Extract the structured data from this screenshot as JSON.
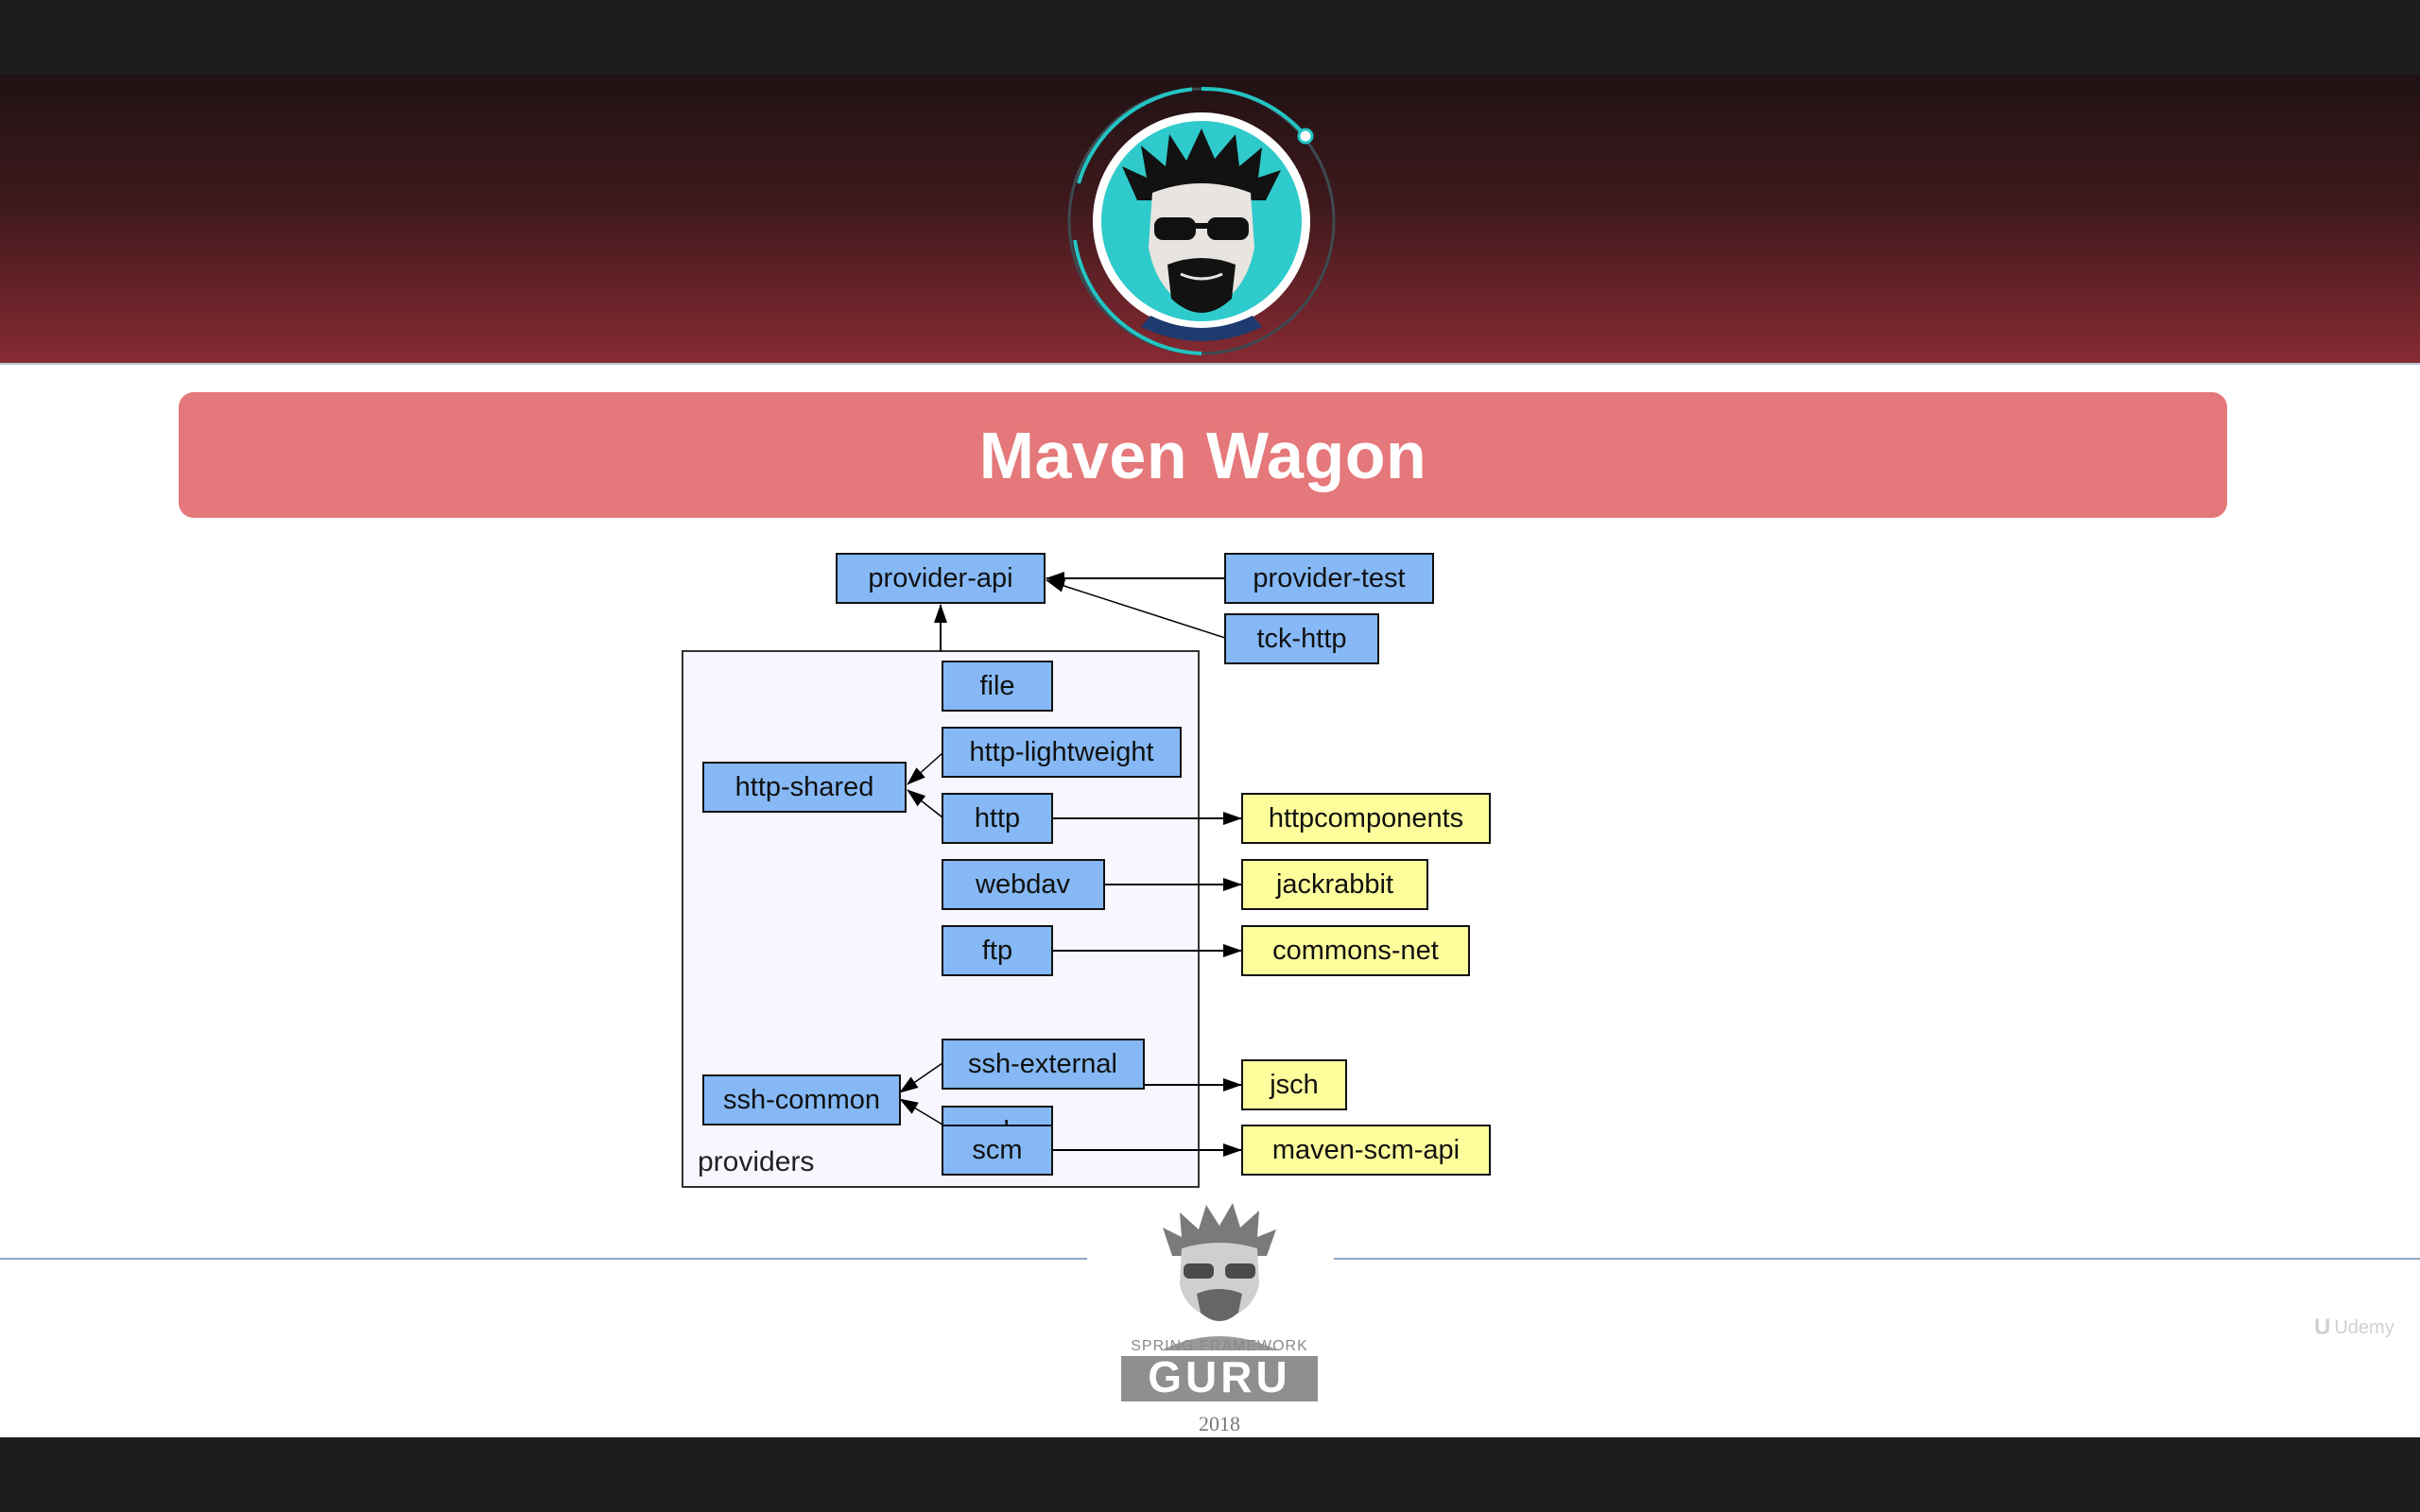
{
  "slide": {
    "title": "Maven Wagon",
    "year": "2018",
    "logo_text": [
      "SPRING FRAMEWORK",
      "GURU"
    ],
    "watermark": "Udemy"
  },
  "colors": {
    "banner_top": "#201214",
    "banner_bottom": "#872a32",
    "title_bar": "#e5787a",
    "module_box": "#85b8f5",
    "external_box": "#fdfd9c",
    "group_fill": "#f8f6fe",
    "avatar_teal": "#22c5c4"
  },
  "icons": [
    "avatar-icon",
    "guru-logo-icon",
    "udemy-logo-icon"
  ],
  "diagram": {
    "group": {
      "label": "providers"
    },
    "nodes": [
      {
        "id": "provider-api",
        "label": "provider-api",
        "kind": "module"
      },
      {
        "id": "provider-test",
        "label": "provider-test",
        "kind": "module"
      },
      {
        "id": "tck-http",
        "label": "tck-http",
        "kind": "module"
      },
      {
        "id": "file",
        "label": "file",
        "kind": "module"
      },
      {
        "id": "http-lightweight",
        "label": "http-lightweight",
        "kind": "module"
      },
      {
        "id": "http-shared",
        "label": "http-shared",
        "kind": "module"
      },
      {
        "id": "http",
        "label": "http",
        "kind": "module"
      },
      {
        "id": "webdav",
        "label": "webdav",
        "kind": "module"
      },
      {
        "id": "ftp",
        "label": "ftp",
        "kind": "module"
      },
      {
        "id": "ssh-external",
        "label": "ssh-external",
        "kind": "module"
      },
      {
        "id": "ssh-common",
        "label": "ssh-common",
        "kind": "module"
      },
      {
        "id": "ssh",
        "label": "ssh",
        "kind": "module"
      },
      {
        "id": "scm",
        "label": "scm",
        "kind": "module"
      },
      {
        "id": "httpcomponents",
        "label": "httpcomponents",
        "kind": "external"
      },
      {
        "id": "jackrabbit",
        "label": "jackrabbit",
        "kind": "external"
      },
      {
        "id": "commons-net",
        "label": "commons-net",
        "kind": "external"
      },
      {
        "id": "jsch",
        "label": "jsch",
        "kind": "external"
      },
      {
        "id": "maven-scm-api",
        "label": "maven-scm-api",
        "kind": "external"
      }
    ],
    "edges": [
      {
        "from": "providers",
        "to": "provider-api"
      },
      {
        "from": "provider-test",
        "to": "provider-api"
      },
      {
        "from": "tck-http",
        "to": "provider-api"
      },
      {
        "from": "http-lightweight",
        "to": "http-shared"
      },
      {
        "from": "http",
        "to": "http-shared"
      },
      {
        "from": "http",
        "to": "httpcomponents"
      },
      {
        "from": "webdav",
        "to": "jackrabbit"
      },
      {
        "from": "ftp",
        "to": "commons-net"
      },
      {
        "from": "ssh-external",
        "to": "ssh-common"
      },
      {
        "from": "ssh",
        "to": "ssh-common"
      },
      {
        "from": "ssh",
        "to": "jsch"
      },
      {
        "from": "scm",
        "to": "maven-scm-api"
      }
    ]
  }
}
